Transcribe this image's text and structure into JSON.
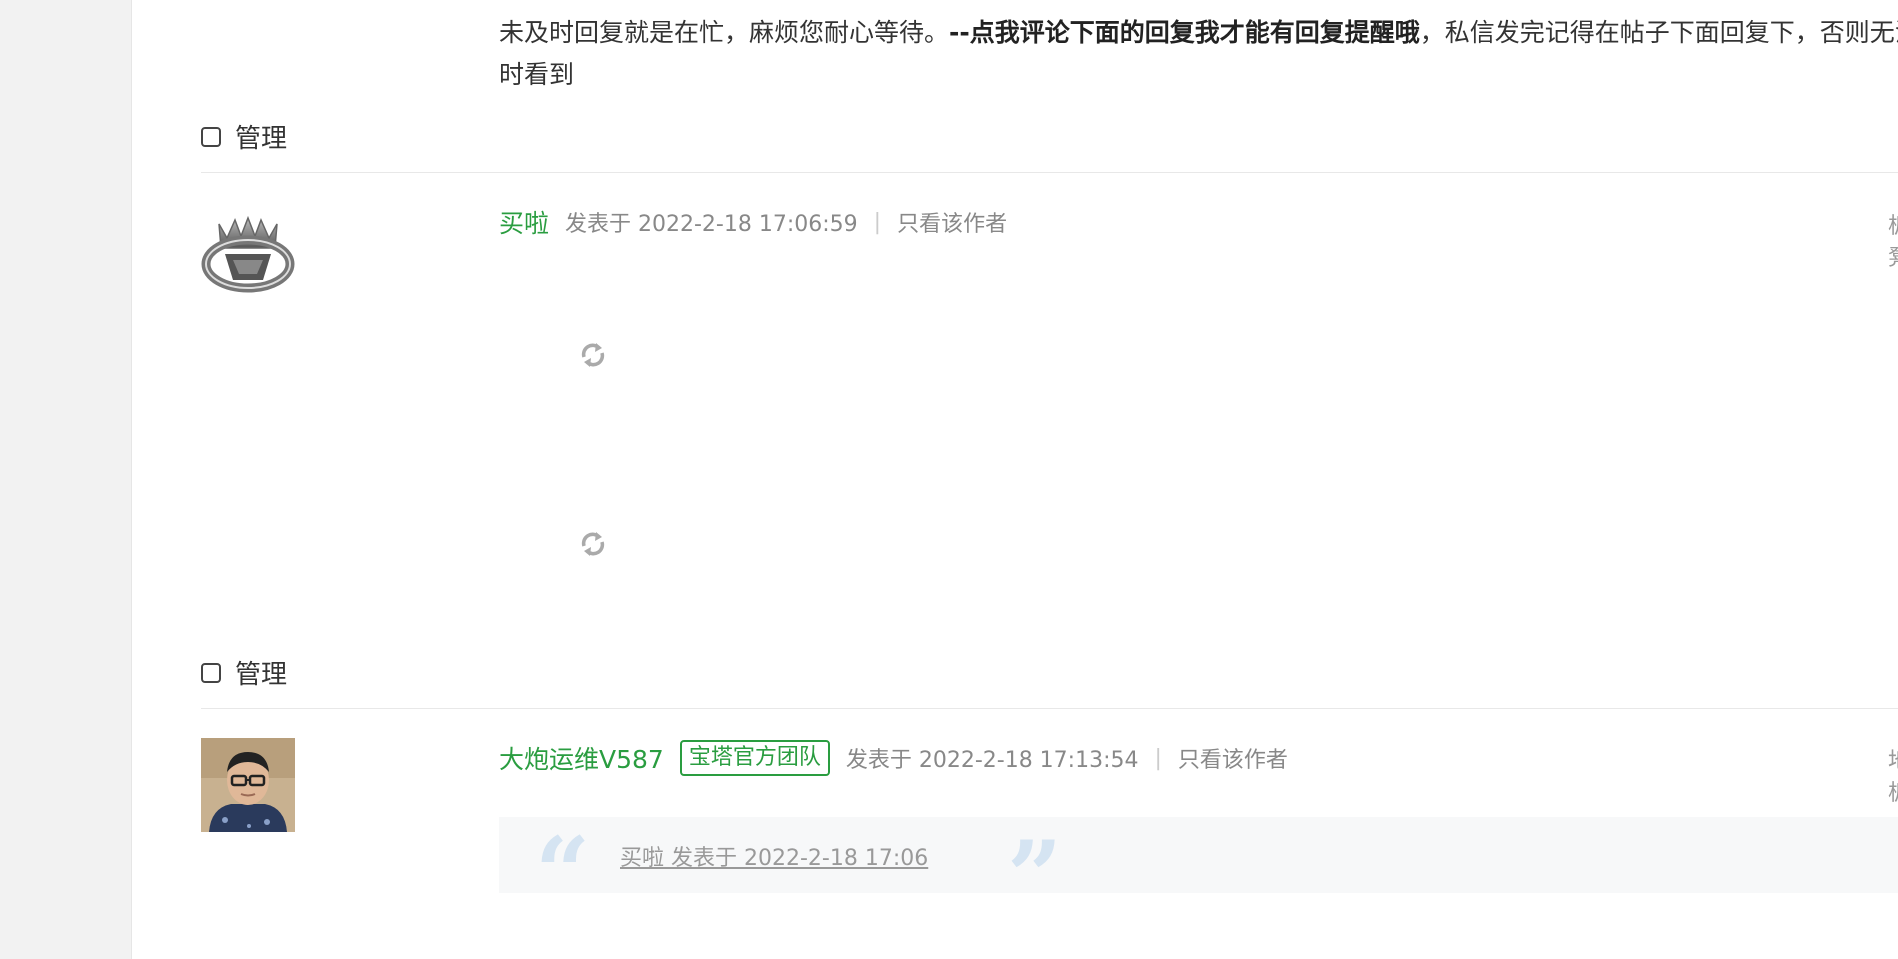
{
  "post1": {
    "text_part1": "未及时回复就是在忙，麻烦您耐心等待。",
    "text_bold": "--点我评论下面的回复我才能有回复提醒哦",
    "text_part2": "，私信发完记得在帖子下面回复下，否则无法及时看到",
    "manage_label": "管理"
  },
  "post2": {
    "author": "买啦",
    "posted_at": "发表于 2022-2-18 17:06:59",
    "only_author": "只看该作者",
    "floor": "板凳",
    "manage_label": "管理"
  },
  "post3": {
    "author": "大炮运维V587",
    "badge": "宝塔官方团队",
    "posted_at": "发表于 2022-2-18 17:13:54",
    "only_author": "只看该作者",
    "floor": "地板",
    "quote": "买啦 发表于 2022-2-18 17:06"
  },
  "icons": {
    "loading": "refresh-icon",
    "avatar_default": "crown-avatar-icon"
  },
  "colors": {
    "author_green": "#2a9d40",
    "quote_mark": "#d5e4f2",
    "quote_bg": "#f7f8f9"
  }
}
